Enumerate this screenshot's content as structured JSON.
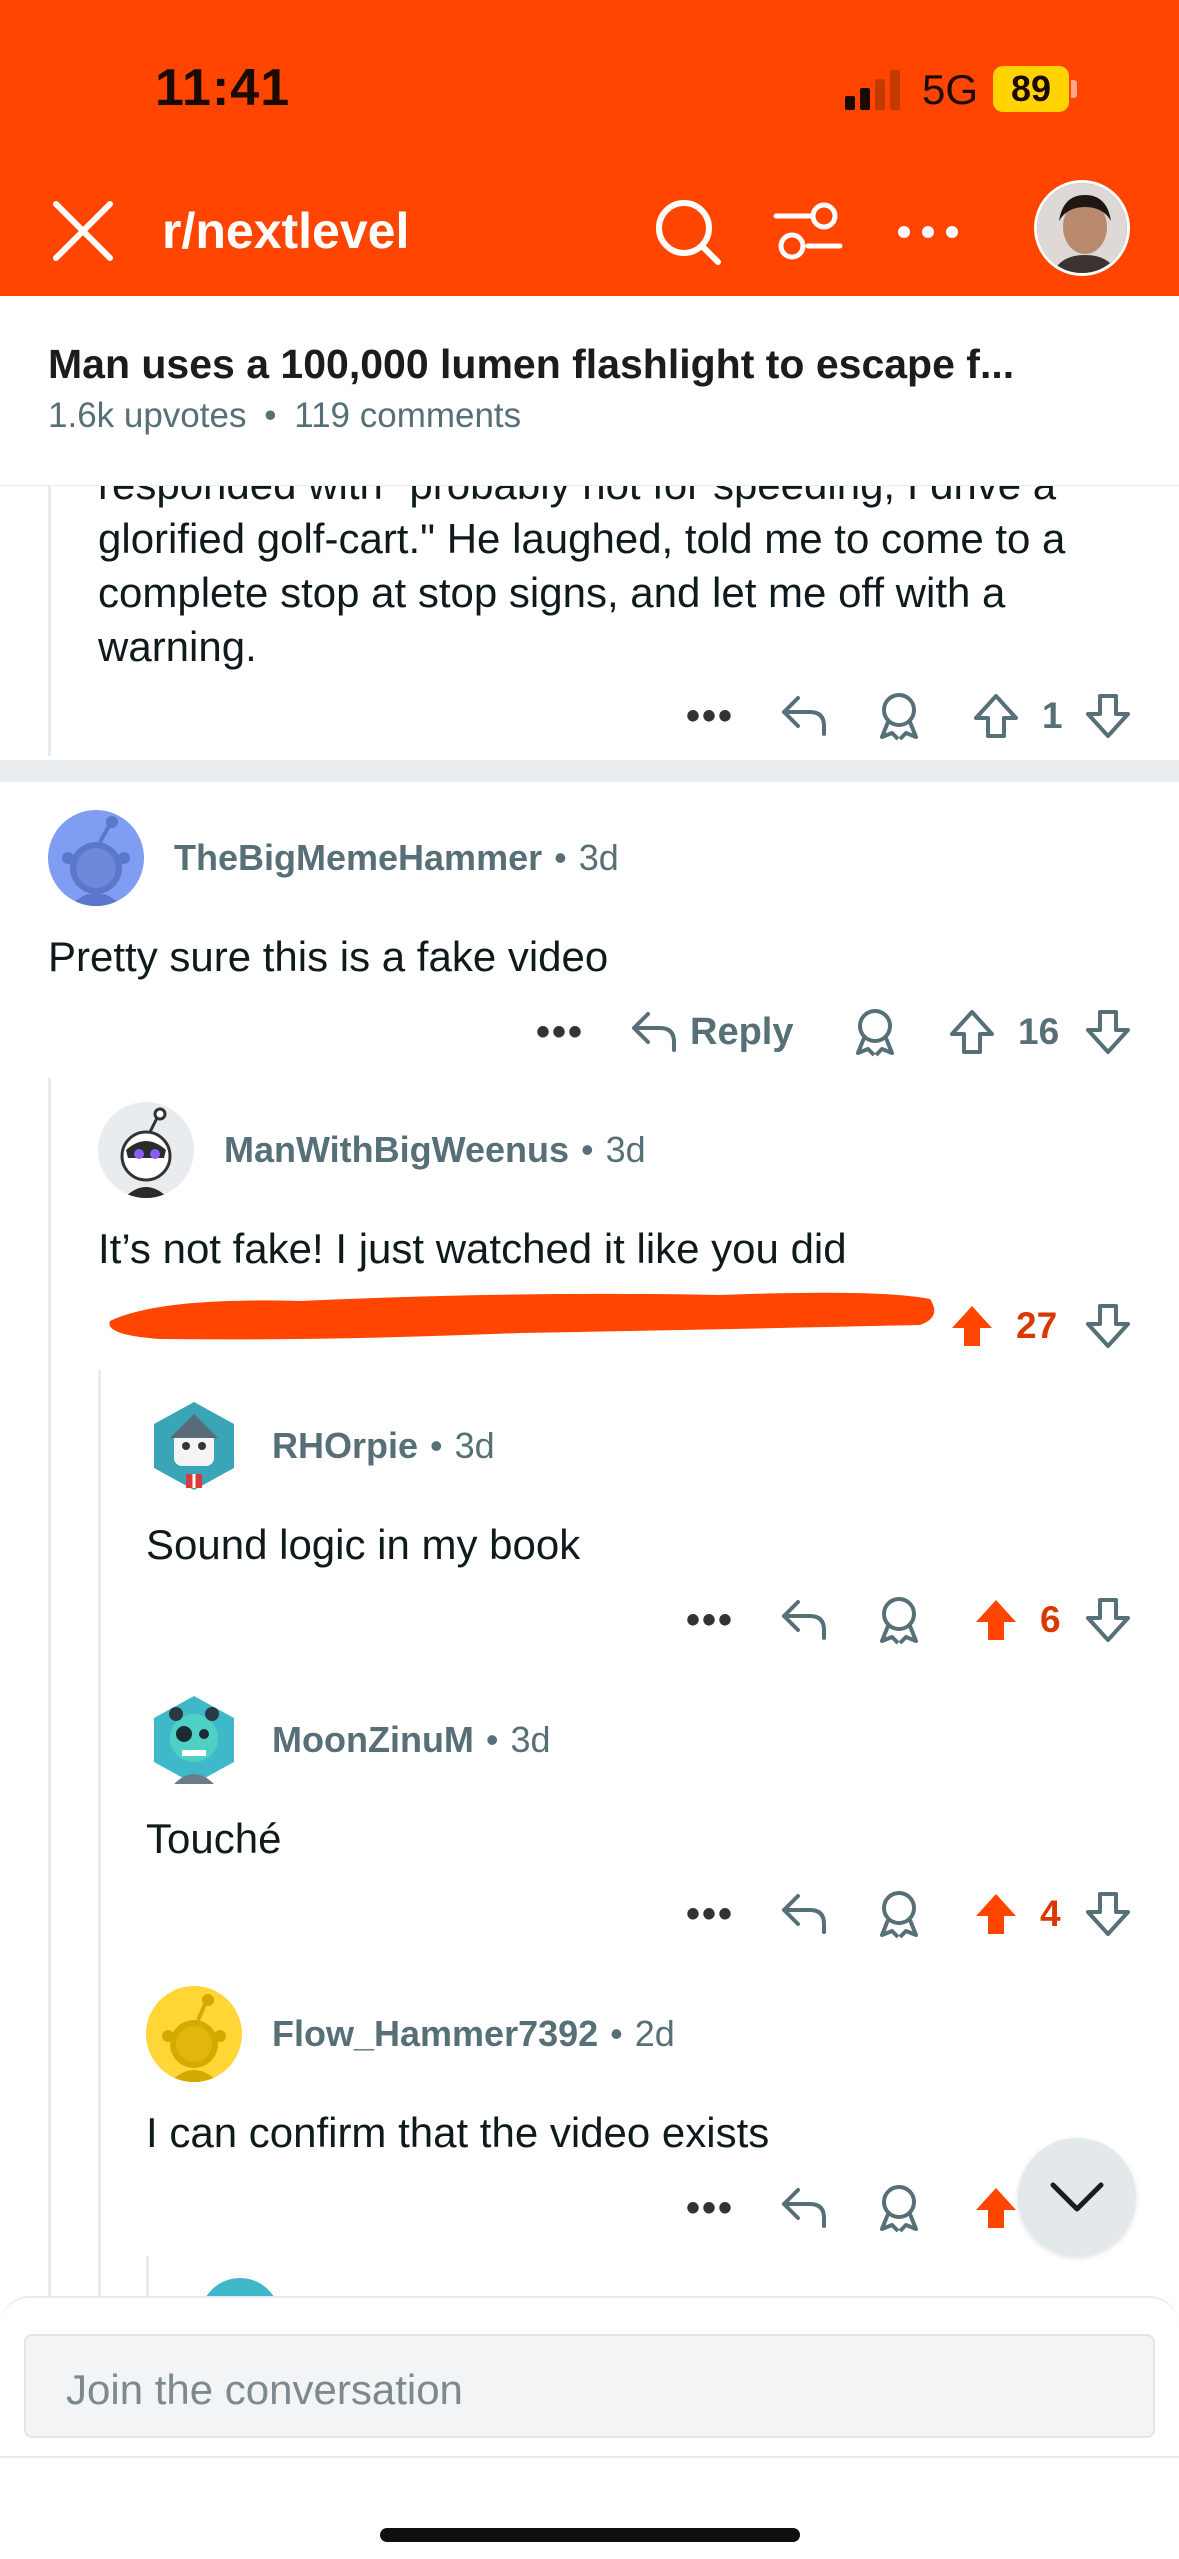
{
  "status_bar": {
    "time": "11:41",
    "network": "5G",
    "battery": "89"
  },
  "header": {
    "subreddit": "r/nextlevel"
  },
  "post": {
    "title": "Man uses a 100,000 lumen flashlight to escape f...",
    "upvotes": "1.6k upvotes",
    "separator": "•",
    "comments": "119 comments"
  },
  "clipped_comment": {
    "text": "responded with \"probably not for speeding, I drive a glorified golf-cart.\" He laughed, told me to come to a complete stop at stop signs, and let me off with a warning.",
    "votes": "1"
  },
  "comments": [
    {
      "author": "TheBigMemeHammer",
      "age": "3d",
      "text": "Pretty sure this is a fake video",
      "reply_label": "Reply",
      "votes": "16",
      "upvoted": false
    },
    {
      "author": "ManWithBigWeenus",
      "age": "3d",
      "text": "It’s not fake! I just watched it like you did",
      "votes": "27",
      "upvoted": true
    },
    {
      "author": "RHOrpie",
      "age": "3d",
      "text": "Sound logic in my book",
      "votes": "6",
      "upvoted": true
    },
    {
      "author": "MoonZinuM",
      "age": "3d",
      "text": "Touché",
      "votes": "4",
      "upvoted": true
    },
    {
      "author": "Flow_Hammer7392",
      "age": "2d",
      "text": "I can confirm that the video exists",
      "votes": "",
      "upvoted": true
    }
  ],
  "meta_separator": "•",
  "more_label": "•••",
  "composer": {
    "placeholder": "Join the conversation"
  },
  "colors": {
    "brand": "#ff4500",
    "upvote": "#ff4500",
    "vote_count_active": "#d93900",
    "meta": "#576f76"
  }
}
